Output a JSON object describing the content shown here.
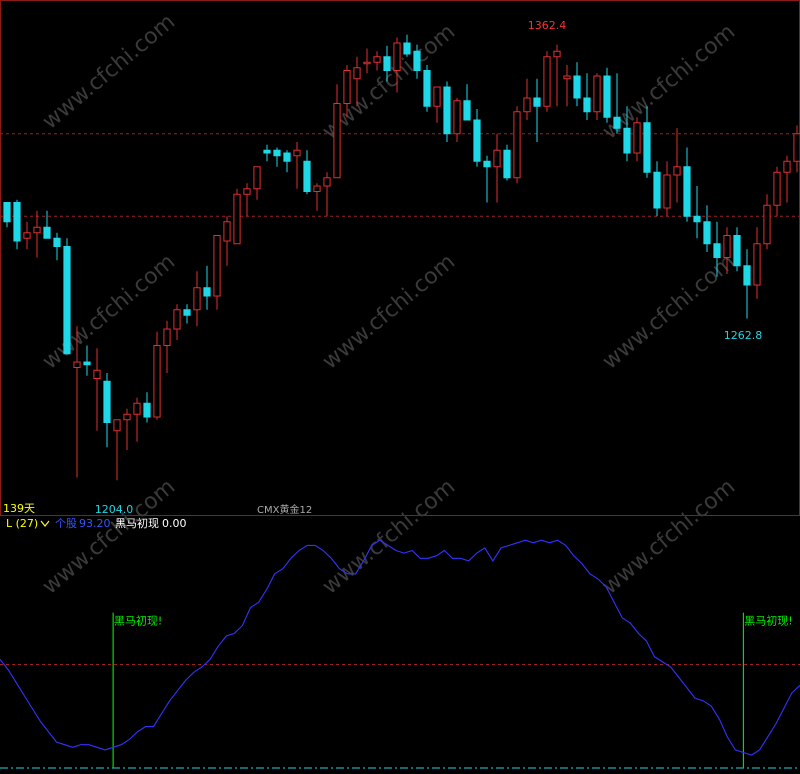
{
  "colors": {
    "background": "#000000",
    "up_candle": "#e03030",
    "down_candle": "#1ed8e8",
    "border": "#8b1a1a",
    "grid": "#a02020",
    "indicator_line": "#3333ff",
    "signal_line": "#00dd00",
    "peak_label": "#ff3030",
    "trough_label": "#1ed8e8",
    "days_label": "#ffff00",
    "indicator_name": "#ffff00",
    "indicator_value": "#3355ff",
    "signal_name": "#ffffff",
    "signal_text": "#00ee00",
    "bottom_line": "#1ed8e8",
    "watermark": "#3a3a3a"
  },
  "main_panel": {
    "days_label": "139天",
    "symbol_label": "CMX黄金12",
    "high_label": "1362.4",
    "low_label": "1204.0",
    "local_low_label": "1262.8",
    "watermark": "www.cfchi.com"
  },
  "indicator_panel": {
    "header_name": "L (27)",
    "dropdown_icon": "chevron-down-icon",
    "series_label": "个股",
    "series_value": "93.20",
    "signal_name": "黑马初现",
    "signal_value": "0.00",
    "signal_marker_text": "黑马初现!"
  },
  "chart_data": [
    {
      "type": "candlestick",
      "title": "CMX黄金12",
      "price_range": [
        1195,
        1375
      ],
      "reference_lines": [
        1330,
        1300
      ],
      "annotations": [
        {
          "text": "1362.4",
          "bar": 54,
          "kind": "high"
        },
        {
          "text": "1204.0",
          "bar": 10,
          "kind": "low"
        },
        {
          "text": "1262.8",
          "bar": 74,
          "kind": "low"
        }
      ],
      "ohlc": [
        [
          1305,
          1305,
          1296,
          1298
        ],
        [
          1305,
          1306,
          1288,
          1291
        ],
        [
          1292,
          1298,
          1288,
          1294
        ],
        [
          1294,
          1302,
          1285,
          1296
        ],
        [
          1296,
          1302,
          1292,
          1292
        ],
        [
          1292,
          1294,
          1284,
          1289
        ],
        [
          1289,
          1292,
          1250,
          1250
        ],
        [
          1245,
          1260,
          1205,
          1247
        ],
        [
          1247,
          1253,
          1242,
          1246
        ],
        [
          1241,
          1252,
          1222,
          1244
        ],
        [
          1240,
          1243,
          1216,
          1225
        ],
        [
          1222,
          1224,
          1204,
          1226
        ],
        [
          1226,
          1230,
          1215,
          1228
        ],
        [
          1228,
          1234,
          1218,
          1232
        ],
        [
          1232,
          1236,
          1225,
          1227
        ],
        [
          1227,
          1258,
          1226,
          1253
        ],
        [
          1253,
          1262,
          1243,
          1259
        ],
        [
          1259,
          1268,
          1255,
          1266
        ],
        [
          1266,
          1268,
          1261,
          1264
        ],
        [
          1266,
          1280,
          1260,
          1274
        ],
        [
          1274,
          1282,
          1266,
          1271
        ],
        [
          1271,
          1293,
          1266,
          1293
        ],
        [
          1291,
          1300,
          1282,
          1298
        ],
        [
          1290,
          1310,
          1290,
          1308
        ],
        [
          1308,
          1312,
          1300,
          1310
        ],
        [
          1310,
          1318,
          1306,
          1318
        ],
        [
          1324,
          1326,
          1320,
          1323
        ],
        [
          1324,
          1325,
          1318,
          1322
        ],
        [
          1323,
          1324,
          1316,
          1320
        ],
        [
          1322,
          1327,
          1310,
          1324
        ],
        [
          1320,
          1324,
          1308,
          1309
        ],
        [
          1309,
          1312,
          1302,
          1311
        ],
        [
          1311,
          1316,
          1300,
          1314
        ],
        [
          1314,
          1348,
          1314,
          1341
        ],
        [
          1341,
          1355,
          1336,
          1353
        ],
        [
          1350,
          1358,
          1340,
          1354
        ],
        [
          1356,
          1361,
          1352,
          1356
        ],
        [
          1356,
          1360,
          1353,
          1358
        ],
        [
          1358,
          1362,
          1349,
          1353
        ],
        [
          1353,
          1365,
          1345,
          1363
        ],
        [
          1363,
          1366,
          1358,
          1359
        ],
        [
          1360,
          1362.4,
          1350,
          1353
        ],
        [
          1353,
          1355,
          1338,
          1340
        ],
        [
          1340,
          1345,
          1334,
          1347
        ],
        [
          1347,
          1349,
          1327,
          1330
        ],
        [
          1330,
          1343,
          1327,
          1342
        ],
        [
          1342,
          1348,
          1336,
          1335
        ],
        [
          1335,
          1339,
          1318,
          1320
        ],
        [
          1320,
          1322,
          1305,
          1318
        ],
        [
          1318,
          1330,
          1305,
          1324
        ],
        [
          1324,
          1326,
          1313,
          1314
        ],
        [
          1314,
          1340,
          1312,
          1338
        ],
        [
          1338,
          1350,
          1335,
          1343
        ],
        [
          1343,
          1350,
          1327,
          1340
        ],
        [
          1340,
          1360,
          1338,
          1358
        ],
        [
          1358,
          1362.4,
          1340,
          1360
        ],
        [
          1350,
          1355,
          1340,
          1351
        ],
        [
          1351,
          1356,
          1340,
          1343
        ],
        [
          1343,
          1352,
          1335,
          1338
        ],
        [
          1338,
          1352,
          1335,
          1351
        ],
        [
          1351,
          1354,
          1334,
          1336
        ],
        [
          1336,
          1352,
          1330,
          1332
        ],
        [
          1332,
          1340,
          1320,
          1323
        ],
        [
          1323,
          1336,
          1320,
          1334
        ],
        [
          1334,
          1340,
          1314,
          1316
        ],
        [
          1316,
          1320,
          1300,
          1303
        ],
        [
          1303,
          1320,
          1300,
          1315
        ],
        [
          1315,
          1332,
          1305,
          1318
        ],
        [
          1318,
          1325,
          1298,
          1300
        ],
        [
          1300,
          1311,
          1292,
          1298
        ],
        [
          1298,
          1304,
          1287,
          1290
        ],
        [
          1290,
          1298,
          1278,
          1285
        ],
        [
          1285,
          1296,
          1279,
          1293
        ],
        [
          1293,
          1296,
          1280,
          1282
        ],
        [
          1282,
          1288,
          1262.8,
          1275
        ],
        [
          1275,
          1296,
          1270,
          1290
        ],
        [
          1290,
          1308,
          1288,
          1304
        ],
        [
          1304,
          1318,
          1300,
          1316
        ],
        [
          1316,
          1322,
          1305,
          1320
        ],
        [
          1320,
          1333,
          1316,
          1330
        ]
      ]
    },
    {
      "type": "line",
      "title": "L (27)",
      "series": [
        {
          "name": "个股",
          "values": [
            62,
            58,
            53,
            48,
            43,
            38,
            34,
            30,
            29,
            28,
            29,
            29,
            28,
            27,
            28,
            29,
            31,
            34,
            36,
            36,
            41,
            46,
            50,
            54,
            57,
            59,
            62,
            67,
            71,
            72,
            75,
            82,
            84,
            89,
            95,
            97,
            101,
            104,
            106,
            106,
            104,
            101,
            97,
            95,
            95,
            100,
            106,
            108,
            106,
            104,
            103,
            104,
            101,
            101,
            102,
            104,
            101,
            101,
            100,
            103,
            105,
            100,
            105,
            106,
            107,
            108,
            107,
            108,
            107,
            108,
            106,
            102,
            99,
            95,
            93,
            90,
            84,
            78,
            76,
            72,
            69,
            63,
            61,
            59,
            55,
            51,
            47,
            46,
            44,
            39,
            32,
            27,
            26,
            25,
            27,
            32,
            37,
            43,
            49,
            52
          ]
        }
      ],
      "reference_lines": [
        60,
        20
      ],
      "signal_bars": [
        14,
        92
      ],
      "signal_text": "黑马初现!"
    }
  ]
}
